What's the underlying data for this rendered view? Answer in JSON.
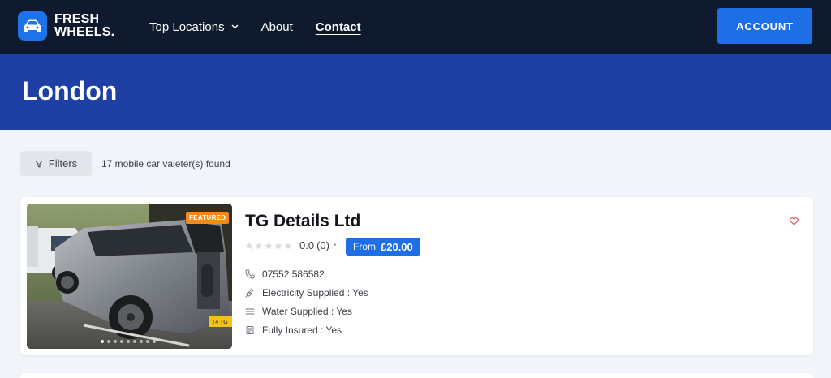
{
  "brand": {
    "line1": "FRESH",
    "line2": "WHEELS."
  },
  "nav": {
    "items": [
      {
        "label": "Top Locations",
        "has_dropdown": true
      },
      {
        "label": "About"
      },
      {
        "label": "Contact",
        "active": true
      }
    ],
    "account_label": "ACCOUNT"
  },
  "hero": {
    "title": "London"
  },
  "filters": {
    "label": "Filters",
    "results_text": "17 mobile car valeter(s) found"
  },
  "listing": {
    "badge": "FEATURED",
    "name": "TG Details Ltd",
    "rating": {
      "value": "0.0",
      "count": "(0)",
      "stars_filled": 0,
      "stars_total": 5
    },
    "price": {
      "prefix": "From",
      "amount": "£20.00"
    },
    "phone": "07552 586582",
    "features": [
      "Electricity Supplied : Yes",
      "Water Supplied : Yes",
      "Fully Insured : Yes"
    ],
    "carousel": {
      "slides": 9,
      "active": 0
    }
  },
  "colors": {
    "header_bg": "#0f1a2e",
    "hero_bg": "#1e3fa3",
    "accent": "#1e6fe6",
    "badge": "#f08a1c",
    "heart": "#d9534f"
  }
}
